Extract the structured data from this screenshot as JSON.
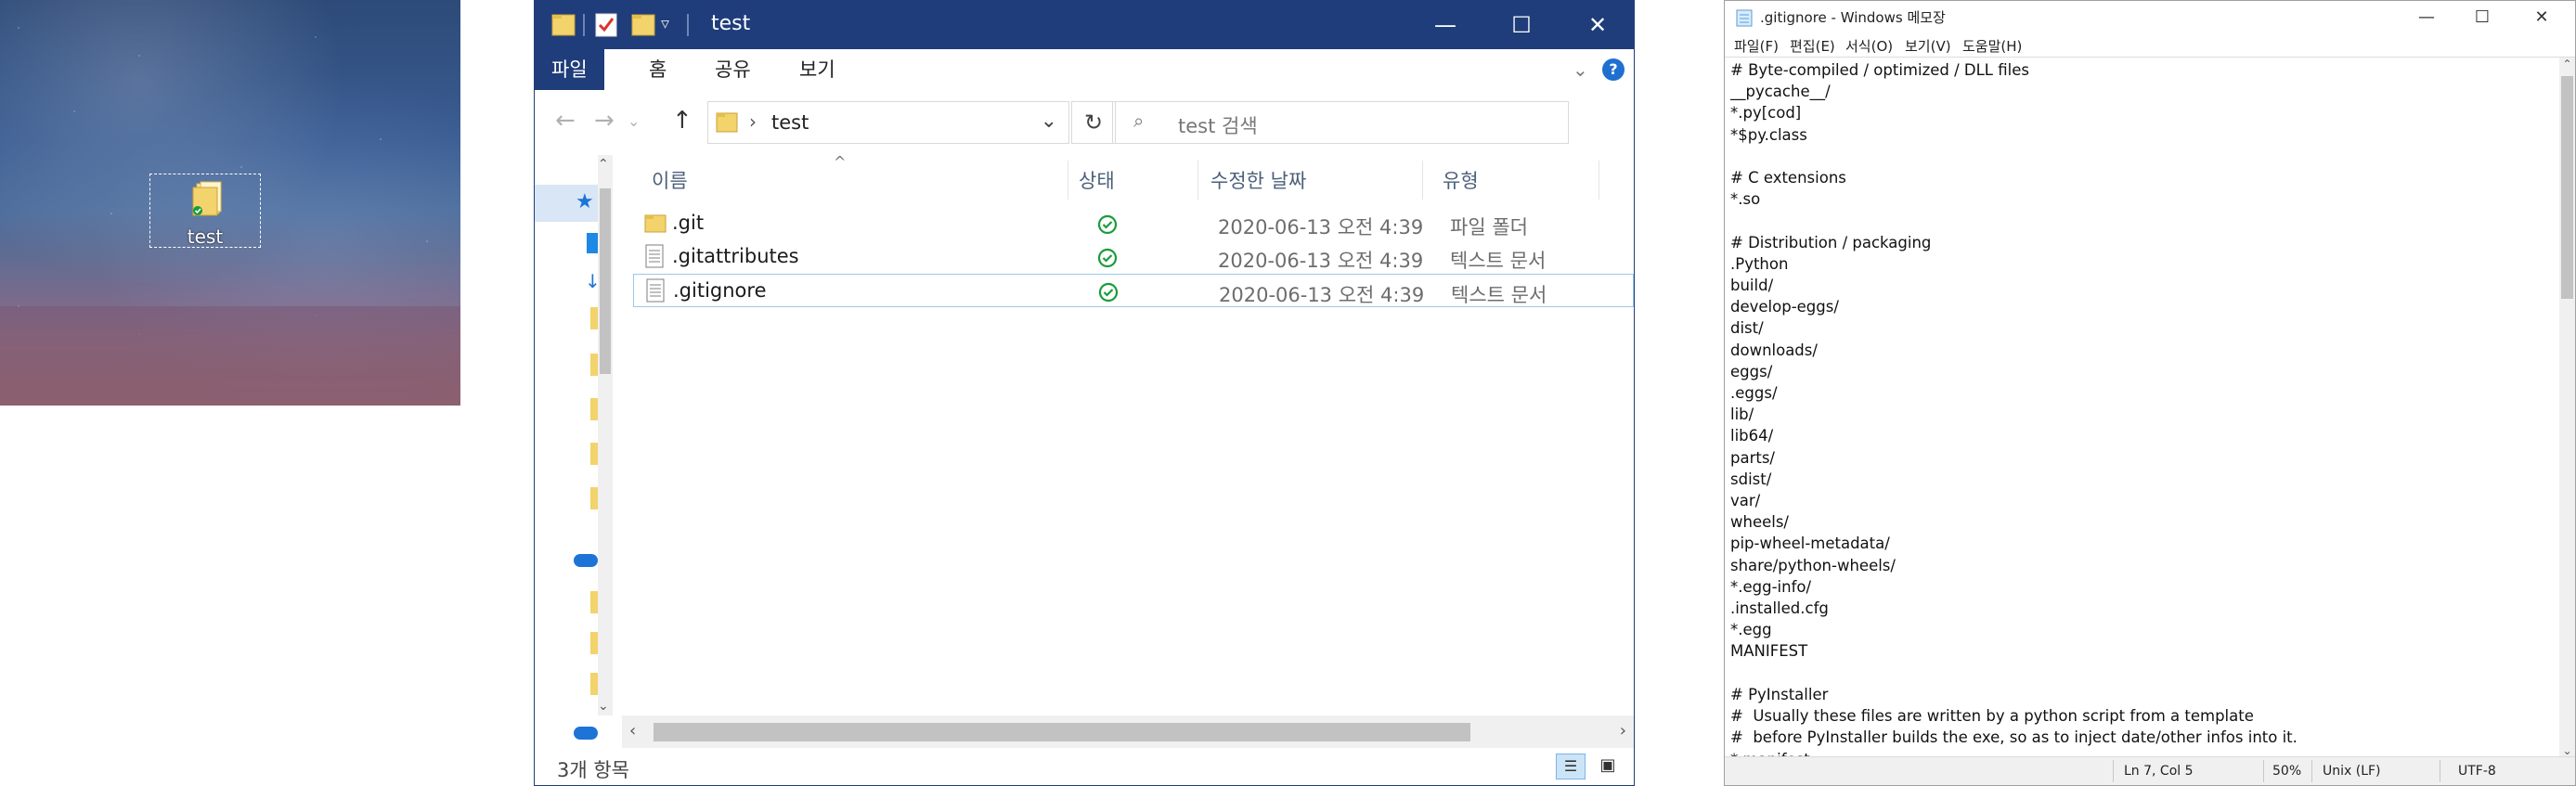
{
  "desktop": {
    "icon_label": "test"
  },
  "explorer": {
    "title": "test",
    "ribbon_tabs": [
      "파일",
      "홈",
      "공유",
      "보기"
    ],
    "address_path": "test",
    "search_placeholder": "test 검색",
    "columns": [
      "이름",
      "상태",
      "수정한 날짜",
      "유형"
    ],
    "files": [
      {
        "name": ".git",
        "date": "2020-06-13 오전 4:39",
        "type": "파일 폴더",
        "icon": "folder-icon"
      },
      {
        "name": ".gitattributes",
        "date": "2020-06-13 오전 4:39",
        "type": "텍스트 문서",
        "icon": "text-file-icon"
      },
      {
        "name": ".gitignore",
        "date": "2020-06-13 오전 4:39",
        "type": "텍스트 문서",
        "icon": "text-file-icon"
      }
    ],
    "status_text": "3개 항목",
    "accent": "#1f3d7a"
  },
  "notepad": {
    "title": ".gitignore - Windows 메모장",
    "menu": [
      "파일(F)",
      "편집(E)",
      "서식(O)",
      "보기(V)",
      "도움말(H)"
    ],
    "content": "# Byte-compiled / optimized / DLL files\n__pycache__/\n*.py[cod]\n*$py.class\n\n# C extensions\n*.so\n\n# Distribution / packaging\n.Python\nbuild/\ndevelop-eggs/\ndist/\ndownloads/\neggs/\n.eggs/\nlib/\nlib64/\nparts/\nsdist/\nvar/\nwheels/\npip-wheel-metadata/\nshare/python-wheels/\n*.egg-info/\n.installed.cfg\n*.egg\nMANIFEST\n\n# PyInstaller\n#  Usually these files are written by a python script from a template\n#  before PyInstaller builds the exe, so as to inject date/other infos into it.\n*.manifest",
    "status": {
      "position": "Ln 7, Col 5",
      "zoom": "50%",
      "line_ending": "Unix (LF)",
      "encoding": "UTF-8"
    }
  }
}
